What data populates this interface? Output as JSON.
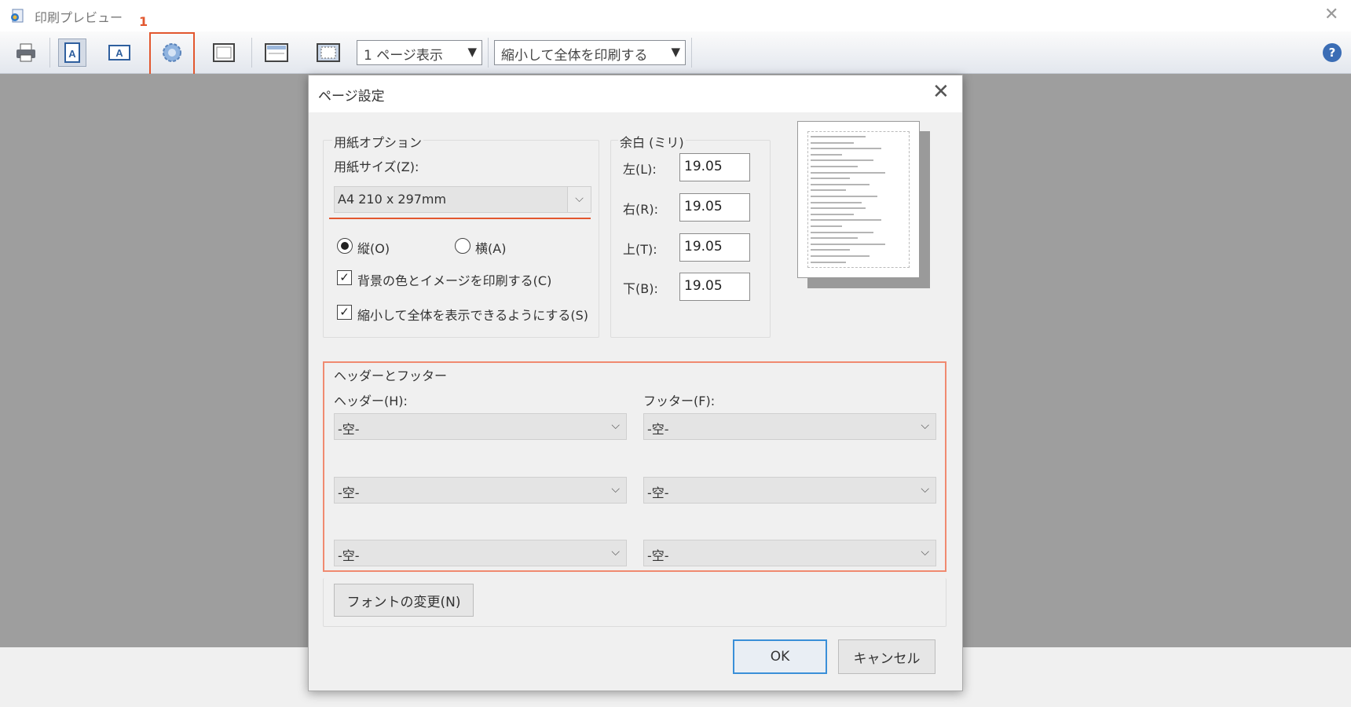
{
  "window": {
    "title": "印刷プレビュー",
    "callout_number": "1"
  },
  "toolbar": {
    "view_select": "1 ページ表示",
    "scale_select": "縮小して全体を印刷する",
    "buttons": [
      "print-icon",
      "portrait-icon",
      "landscape-icon",
      "page-setup-icon",
      "full-page-icon",
      "header-footer-icon",
      "fit-page-icon"
    ]
  },
  "dialog": {
    "title": "ページ設定",
    "paper_options": {
      "group_label": "用紙オプション",
      "size_label": "用紙サイズ(Z):",
      "size_value": "A4 210 x 297mm",
      "portrait_label": "縦(O)",
      "landscape_label": "横(A)",
      "orientation_selected": "portrait",
      "print_bg_label": "背景の色とイメージを印刷する(C)",
      "print_bg_checked": true,
      "shrink_label": "縮小して全体を表示できるようにする(S)",
      "shrink_checked": true
    },
    "margins": {
      "group_label": "余白 (ミリ)",
      "left_label": "左(L):",
      "left_value": "19.05",
      "right_label": "右(R):",
      "right_value": "19.05",
      "top_label": "上(T):",
      "top_value": "19.05",
      "bottom_label": "下(B):",
      "bottom_value": "19.05"
    },
    "header_footer": {
      "group_label": "ヘッダーとフッター",
      "header_label": "ヘッダー(H):",
      "footer_label": "フッター(F):",
      "header_values": [
        "-空-",
        "-空-",
        "-空-"
      ],
      "footer_values": [
        "-空-",
        "-空-",
        "-空-"
      ]
    },
    "change_font_label": "フォントの変更(N)",
    "ok_label": "OK",
    "cancel_label": "キャンセル"
  }
}
